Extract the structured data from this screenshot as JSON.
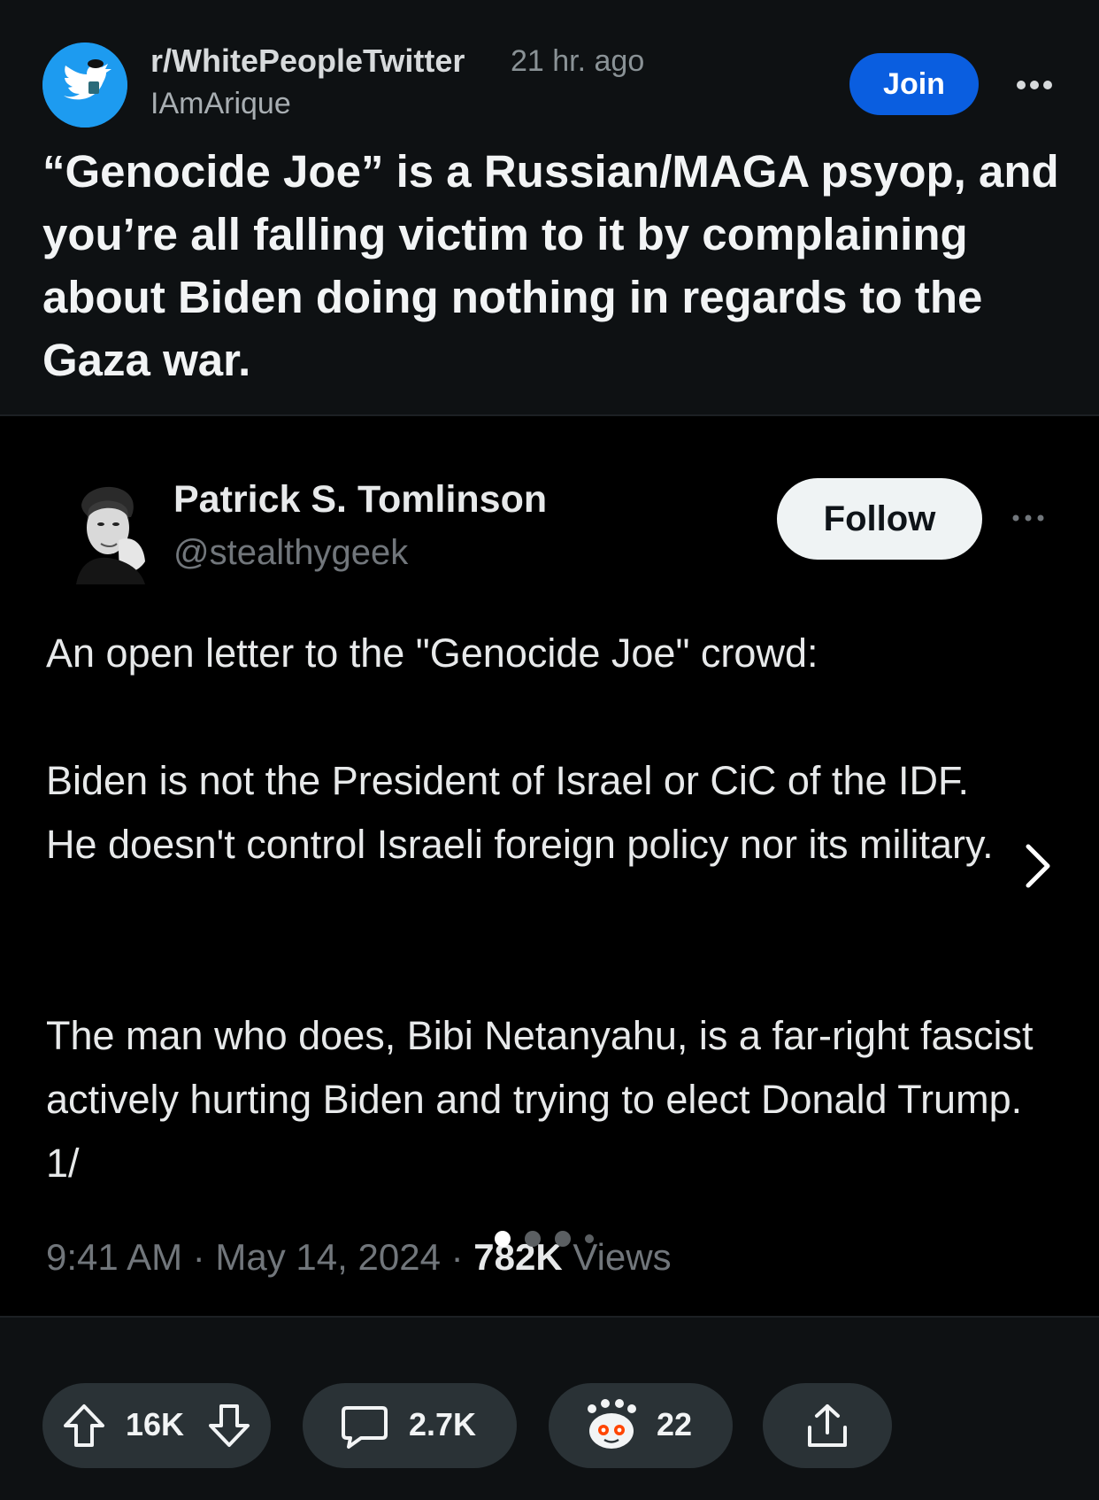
{
  "post": {
    "subreddit": "r/WhitePeopleTwitter",
    "time": "21 hr. ago",
    "author": "IAmArique",
    "join_label": "Join",
    "title": "“Genocide Joe” is a Russian/MAGA psyop, and you’re all falling victim to it by complaining about Biden doing nothing in regards to the Gaza war."
  },
  "tweet": {
    "name": "Patrick S. Tomlinson",
    "handle": "@stealthygeek",
    "follow_label": "Follow",
    "paragraphs": [
      "An open letter to the \"Genocide Joe\" crowd:",
      "Biden is not the President of Israel or CiC of the IDF. He doesn't control Israeli foreign policy nor its military.",
      "The man who does, Bibi Netanyahu, is a far-right fascist actively hurting Biden and trying to elect Donald Trump. 1/"
    ],
    "meta_prefix": "9:41 AM · May 14, 2024 · ",
    "views_count": "782K",
    "views_label": " Views"
  },
  "carousel": {
    "total": 4,
    "active": 0
  },
  "actions": {
    "votes": "16K",
    "comments": "2.7K",
    "awards": "22"
  },
  "colors": {
    "join_bg": "#0a5ee0",
    "pill_bg": "#2a3236",
    "page_bg": "#0e1113",
    "media_bg": "#000000",
    "twitter_blue": "#1d9bf0"
  },
  "icons": {
    "subreddit": "twitter-bird-icon",
    "more": "more-horizontal-icon",
    "next": "chevron-right-icon",
    "upvote": "upvote-arrow-icon",
    "downvote": "downvote-arrow-icon",
    "comment": "comment-bubble-icon",
    "award": "snoo-award-icon",
    "share": "share-icon"
  }
}
